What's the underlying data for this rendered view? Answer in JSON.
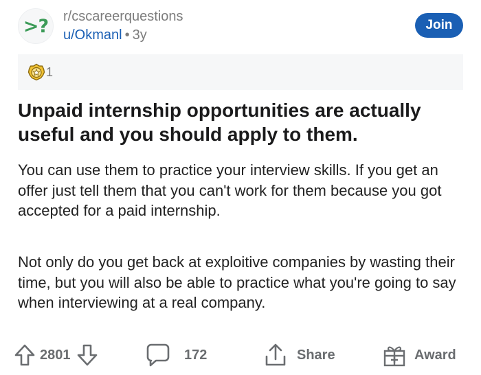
{
  "subreddit": {
    "icon_text": ">?",
    "name": "r/cscareerquestions",
    "join_label": "Join"
  },
  "author": {
    "username": "u/Okmanl",
    "separator": "•",
    "age": "3y"
  },
  "awards": {
    "count": "1",
    "icon": "award-badge-icon"
  },
  "post": {
    "title": "Unpaid internship opportunities are actually useful and you should apply to them.",
    "paragraphs": [
      "You can use them to practice your interview skills. If you get an offer just tell them that you can't work for them because you got accepted for a paid internship.",
      "Not only do you get back at exploitive companies by wasting their time, but you will also be able to practice what you're going to say when interviewing at a real company."
    ]
  },
  "actions": {
    "vote_count": "2801",
    "comment_count": "172",
    "share_label": "Share",
    "award_label": "Award"
  },
  "colors": {
    "accent": "#1a5fb4",
    "subreddit_icon": "#3c9b58",
    "muted": "#7c7c7c",
    "award_bar_bg": "#f6f7f8"
  }
}
